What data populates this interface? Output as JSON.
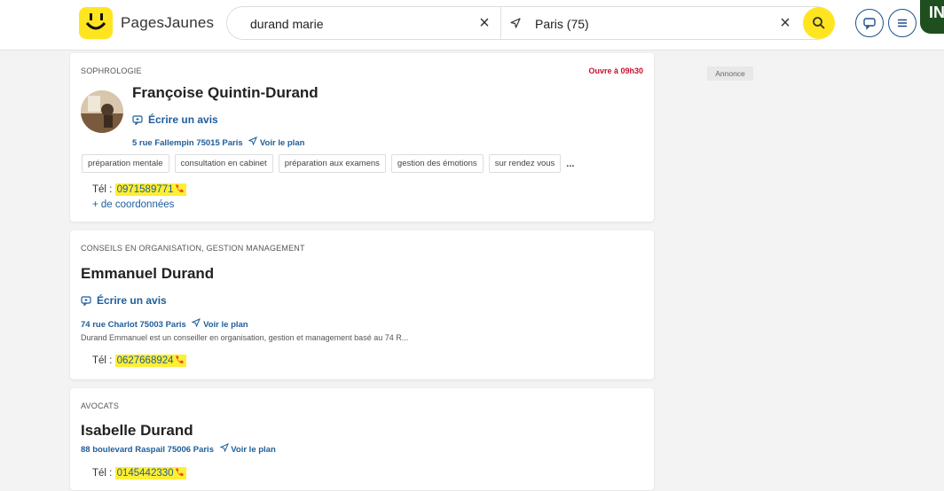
{
  "header": {
    "logo_text": "PagesJaunes",
    "search_what": "durand marie",
    "search_where": "Paris (75)",
    "connect_label": "IN"
  },
  "annonce_label": "Annonce",
  "results": [
    {
      "category": "SOPHROLOGIE",
      "opening": "Ouvre à 09h30",
      "name": "Françoise Quintin-Durand",
      "review": "Écrire un avis",
      "address": "5 rue Fallempin 75015 Paris",
      "plan": "Voir le plan",
      "tags": [
        "préparation mentale",
        "consultation en cabinet",
        "préparation aux examens",
        "gestion des émotions",
        "sur rendez vous"
      ],
      "tags_more": "...",
      "phone_label": "Tél :",
      "phone": "0971589771",
      "more_coords": "+ de coordonnées"
    },
    {
      "category": "CONSEILS EN ORGANISATION, GESTION MANAGEMENT",
      "name": "Emmanuel Durand",
      "review": "Écrire un avis",
      "address": "74 rue Charlot 75003 Paris",
      "plan": "Voir le plan",
      "description": "Durand Emmanuel est un conseiller en organisation, gestion et management basé au 74 R...",
      "phone_label": "Tél :",
      "phone": "0627668924"
    },
    {
      "category": "AVOCATS",
      "name": "Isabelle Durand",
      "address": "88 boulevard Raspail 75006 Paris",
      "plan": "Voir le plan",
      "phone_label": "Tél :",
      "phone": "0145442330"
    }
  ],
  "colors": {
    "brand_yellow": "#ffe51f",
    "link_blue": "#1e5d9b",
    "opening_red": "#c8102e",
    "phone_highlight": "#ffee33"
  }
}
